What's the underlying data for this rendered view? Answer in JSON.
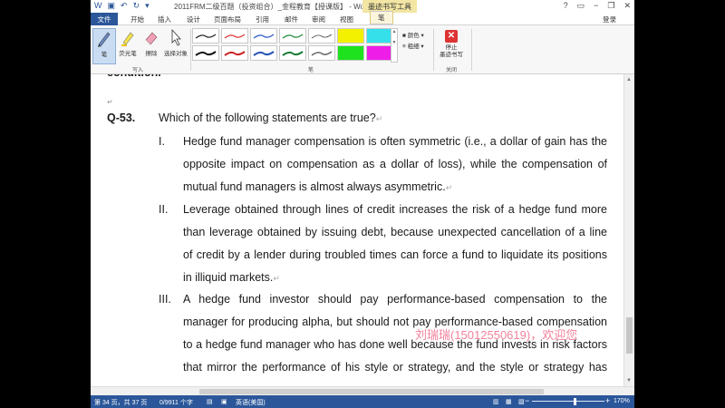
{
  "window": {
    "title": "2011FRM二级百题（投资组合）_金程教育【授课版】 - Word",
    "tool_tab": "墨迹书写工具",
    "help": "?",
    "minimize": "−",
    "restore": "❐",
    "close": "✕"
  },
  "tabs": {
    "file": "文件",
    "home": "开始",
    "insert": "插入",
    "design": "设计",
    "layout": "页面布局",
    "references": "引用",
    "mailings": "邮件",
    "review": "审阅",
    "view": "视图",
    "pen": "笔",
    "login": "登录"
  },
  "ribbon": {
    "pen_label": "笔",
    "highlighter_label": "荧光笔",
    "eraser_label": "擦除",
    "select_label": "选择对象",
    "write_group": "写入",
    "pens_group": "笔",
    "color_label": "颜色",
    "thickness_label": "粗细",
    "stop_label_1": "停止",
    "stop_label_2": "墨迹书写",
    "close_group": "关闭"
  },
  "document": {
    "cut_line": "condition.",
    "q_number": "Q-53.",
    "q_text": "Which of the following statements are true?",
    "items": [
      {
        "numeral": "I.",
        "lines": [
          "Hedge fund manager compensation is often symmetric (i.e., a dollar of gain has the",
          "opposite impact on compensation as a dollar of loss), while the compensation of",
          "mutual fund managers is almost always asymmetric."
        ]
      },
      {
        "numeral": "II.",
        "lines": [
          "Leverage obtained through lines of credit increases the risk of a hedge fund more",
          "than leverage obtained by issuing debt, because unexpected cancellation of a line",
          "of credit by a lender during troubled times can force a fund to liquidate its positions",
          "in illiquid markets."
        ]
      },
      {
        "numeral": "III.",
        "lines": [
          "A hedge fund investor should pay performance-based compensation to the",
          "manager for producing alpha, but should not pay performance-based compensation",
          "to a hedge fund manager who has done well because the fund invests in risk factors",
          "that mirror the performance of his style or strategy, and the style or strategy has"
        ]
      }
    ],
    "watermark": "刘瑞瑞(15012550619)，欢迎您"
  },
  "statusbar": {
    "page": "第 34 页，共 37 页",
    "words": "0/9911 个字",
    "language": "英语(美国)",
    "zoom": "170%",
    "zoom_out": "−",
    "zoom_in": "+"
  },
  "colors": {
    "accent": "#2b579a",
    "tool_tab": "#f3e6a4",
    "watermark": "#f26b8a"
  }
}
